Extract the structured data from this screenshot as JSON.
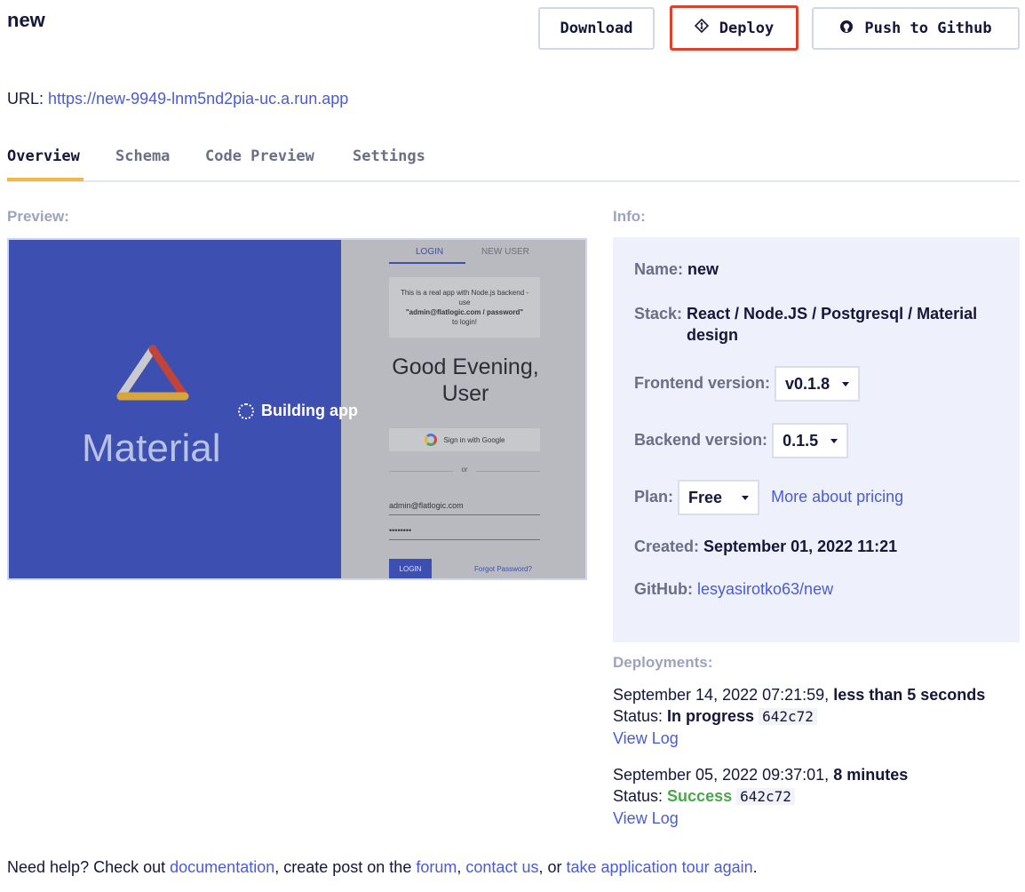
{
  "project": {
    "title": "new"
  },
  "toolbar": {
    "download_label": "Download",
    "deploy_label": "Deploy",
    "github_label": "Push to Github"
  },
  "url": {
    "label": "URL:",
    "value": "https://new-9949-lnm5nd2pia-uc.a.run.app"
  },
  "tabs": [
    {
      "label": "Overview",
      "active": true
    },
    {
      "label": "Schema",
      "active": false
    },
    {
      "label": "Code Preview",
      "active": false
    },
    {
      "label": "Settings",
      "active": false
    }
  ],
  "preview": {
    "label": "Preview:",
    "status": "Building app",
    "brand_word": "Material",
    "login_tab": "LOGIN",
    "new_user_tab": "NEW USER",
    "note_lines": [
      "This is a real app with Node.js backend -",
      "use",
      "\"admin@flatlogic.com / password\"",
      "to login!"
    ],
    "greeting_line1": "Good Evening,",
    "greeting_line2": "User",
    "google_button": "Sign in with Google",
    "or_text": "or",
    "email_value": "admin@flatlogic.com",
    "password_value": "••••••••",
    "login_button": "LOGIN",
    "forgot_link": "Forgot Password?"
  },
  "info": {
    "label": "Info:",
    "name_key": "Name:",
    "name_value": "new",
    "stack_key": "Stack:",
    "stack_line1": "React / Node.JS / Postgresql / Material",
    "stack_line2": "design",
    "frontend_key": "Frontend version:",
    "frontend_value": "v0.1.8",
    "backend_key": "Backend version:",
    "backend_value": "0.1.5",
    "plan_key": "Plan:",
    "plan_value": "Free",
    "pricing_link": "More about pricing",
    "created_key": "Created:",
    "created_value": "September 01, 2022 11:21",
    "github_key": "GitHub:",
    "github_value": "lesyasirotko63/new"
  },
  "deployments": {
    "label": "Deployments:",
    "items": [
      {
        "date": "September 14, 2022 07:21:59,",
        "duration": "less than 5 seconds",
        "status_label": "Status:",
        "status": "In progress",
        "hash": "642c72",
        "log_link": "View Log"
      },
      {
        "date": "September 05, 2022 09:37:01,",
        "duration": "8 minutes",
        "status_label": "Status:",
        "status": "Success",
        "hash": "642c72",
        "log_link": "View Log"
      }
    ]
  },
  "help": {
    "prefix": "Need help? Check out",
    "doc_link": "documentation",
    "mid1": ", create post on the",
    "forum_link": "forum",
    "comma": ",",
    "contact_link": "contact us",
    "mid2": ", or",
    "tour_link": "take application tour again",
    "end": "."
  },
  "colors": {
    "accent_link": "#4a5bd9",
    "deploy_border": "#e0402a",
    "tab_underline": "#f0b847",
    "success": "#4aa64a",
    "preview_blue": "#3d4fb0"
  }
}
